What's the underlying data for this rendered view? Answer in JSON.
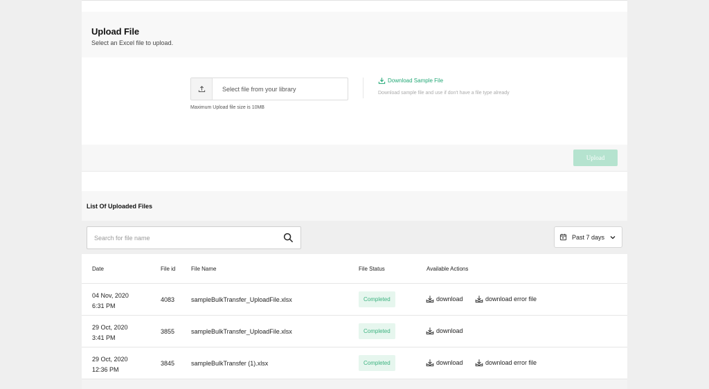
{
  "upload": {
    "title": "Upload File",
    "subtitle": "Select an Excel file to upload.",
    "picker_placeholder": "Select file from your library",
    "max_size_note": "Maximum Upload file size is 10MB",
    "sample_link": "Download Sample File",
    "sample_hint": "Download sample file and use if don't have a file type already",
    "upload_button": "Upload"
  },
  "list": {
    "title": "List Of Uploaded Files",
    "search_placeholder": "Search for file name",
    "date_filter": "Past 7 days",
    "columns": [
      "Date",
      "File id",
      "File Name",
      "File Status",
      "Available Actions"
    ],
    "rows": [
      {
        "date": "04 Nov, 2020",
        "time": "6:31 PM",
        "id": "4083",
        "name": "sampleBulkTransfer_UploadFile.xlsx",
        "status": "Completed",
        "actions": [
          "download",
          "download error file"
        ]
      },
      {
        "date": "29 Oct, 2020",
        "time": "3:41 PM",
        "id": "3855",
        "name": "sampleBulkTransfer_UploadFile.xlsx",
        "status": "Completed",
        "actions": [
          "download"
        ]
      },
      {
        "date": "29 Oct, 2020",
        "time": "12:36 PM",
        "id": "3845",
        "name": "sampleBulkTransfer (1).xlsx",
        "status": "Completed",
        "actions": [
          "download",
          "download error file"
        ]
      }
    ]
  },
  "colors": {
    "accent_green": "#22a876",
    "upload_button_disabled": "#b5e3cf",
    "badge_bg": "#e6f6ee",
    "badge_text": "#3bb27f",
    "page_bg": "#efefef"
  },
  "icons": {
    "picker": "upload-icon",
    "sample": "download-icon",
    "search": "search-icon",
    "calendar": "calendar-icon",
    "chevron": "chevron-down-icon",
    "action": "download-tray-icon"
  }
}
